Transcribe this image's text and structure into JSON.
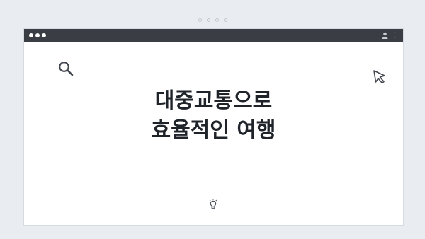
{
  "window": {
    "menu_glyph": "⋮"
  },
  "content": {
    "headline_line1": "대중교통으로",
    "headline_line2": "효율적인 여행"
  },
  "icons": {
    "window_controls": "traffic-light-dots",
    "profile": "user-icon",
    "menu": "kebab-menu-icon",
    "search": "magnifier-icon",
    "cursor": "mouse-pointer-icon",
    "bulb": "lightbulb-icon",
    "pager": "page-dots"
  },
  "colors": {
    "background": "#e9ecf1",
    "titlebar": "#3a3d44",
    "window_bg": "#ffffff",
    "headline": "#1f232a",
    "icon_stroke": "#444851"
  }
}
